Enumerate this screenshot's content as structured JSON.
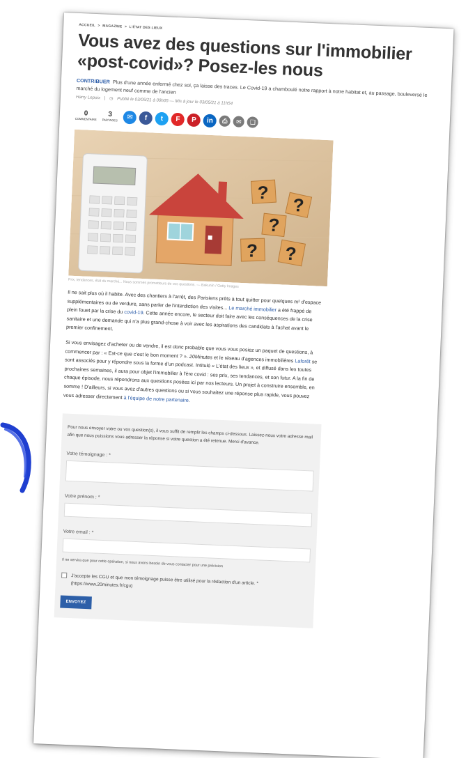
{
  "breadcrumb": {
    "items": [
      "ACCUEIL",
      ">",
      "MAGAZINE",
      ">",
      "L'ÉTAT DES LIEUX"
    ]
  },
  "article": {
    "title": "Vous avez des questions sur l'immobilier «post-covid»? Posez-les nous",
    "lead_tag": "CONTRIBUER",
    "lead_text": "Plus d'une année enfermé chez soi, ça laisse des traces. Le Covid-19 a chamboulé notre rapport à notre habitat et, au passage, bouleversé le marché du logement neuf comme de l'ancien",
    "author": "Harry Lepoix",
    "separator": "|",
    "published": "Publié le 03/05/21 à 09h05 — Mis à jour le 03/05/21 à 11h54"
  },
  "share": {
    "comments": {
      "count": "0",
      "label": "COMMENTAIRE"
    },
    "shares": {
      "count": "3",
      "label": "PARTAGES"
    },
    "icons": [
      {
        "name": "messenger-icon",
        "glyph": "✉",
        "color": "#1e88e5"
      },
      {
        "name": "facebook-icon",
        "glyph": "f",
        "color": "#3b5998"
      },
      {
        "name": "twitter-icon",
        "glyph": "t",
        "color": "#1da1f2"
      },
      {
        "name": "flipboard-icon",
        "glyph": "F",
        "color": "#e12828"
      },
      {
        "name": "pinterest-icon",
        "glyph": "P",
        "color": "#cb2027"
      },
      {
        "name": "linkedin-icon",
        "glyph": "in",
        "color": "#0a66c2"
      },
      {
        "name": "print-icon",
        "glyph": "⎙",
        "color": "#7a7a7a"
      },
      {
        "name": "email-icon",
        "glyph": "✉",
        "color": "#7a7a7a"
      },
      {
        "name": "bookmark-icon",
        "glyph": "❑",
        "color": "#7a7a7a"
      }
    ]
  },
  "image": {
    "caption": "Prix, tendances, état du marché... Nous sommes prometteurs de vos questions. — Bakunin / Getty Images"
  },
  "body": {
    "p1_a": "Il ne sait plus où il habite. Avec des chantiers à l'arrêt, des Parisiens prêts à tout quitter pour quelques m² d'espace supplémentaires ou de verdure, sans parler de l'interdiction des visites... ",
    "p1_link1": "Le marché immobilier",
    "p1_b": " a été frappé de plein fouet par la crise du ",
    "p1_link2": "covid-19",
    "p1_c": ". Cette année encore, le secteur doit faire avec les conséquences de la crise sanitaire et une demande qui n'a plus grand-chose à voir avec les aspirations des candidats à l'achat avant le premier confinement.",
    "p2_a": "Si vous envisagez d'acheter ou de vendre, il est donc probable que vous vous posiez un paquet de questions, à commencer par : « Est-ce que c'est le bon moment ? ». ",
    "p2_em": "20Minutes",
    "p2_b": " et le réseau d'agences immobilières ",
    "p2_link1": "Laforêt",
    "p2_c": " se sont associés pour y répondre sous la forme d'un podcast. Intitulé « L'état des lieux », et diffusé dans les toutes prochaines semaines, il aura pour objet l'immobilier à l'ère covid : ses prix, ses tendances, et son futur. A la fin de chaque épisode, nous répondrons aux questions posées ici par nos lecteurs. Un projet à construire ensemble, en somme ! D'ailleurs, si vous avez d'autres questions ou si vous souhaitez une réponse plus rapide, vous pouvez vous adresser directement ",
    "p2_link2": "à l'équipe de notre partenaire",
    "p2_d": "."
  },
  "form": {
    "intro": "Pour nous envoyer votre ou vos question(s), il vous suffit de remplir les champs ci-dessous. Laissez-nous votre adresse mail afin que nous puissions vous adresser la réponse si votre question a été retenue. Merci d'avance.",
    "testimony_label": "Votre témoignage : *",
    "firstname_label": "Votre prénom : *",
    "email_label": "Votre email : *",
    "email_hint": "Il ne servira que pour cette opération, si nous avons besoin de vous contacter pour une précision",
    "consent_text": "J'accepte les CGU et que mon témoignage puisse être utilisé pour la rédaction d'un article. * (https://www.20minutes.fr/cgu)",
    "submit_label": "ENVOYEZ"
  },
  "colors": {
    "link": "#2a5ba8",
    "button": "#2d5fa8",
    "pen": "#1f3fd0",
    "roof": "#c9443c"
  }
}
